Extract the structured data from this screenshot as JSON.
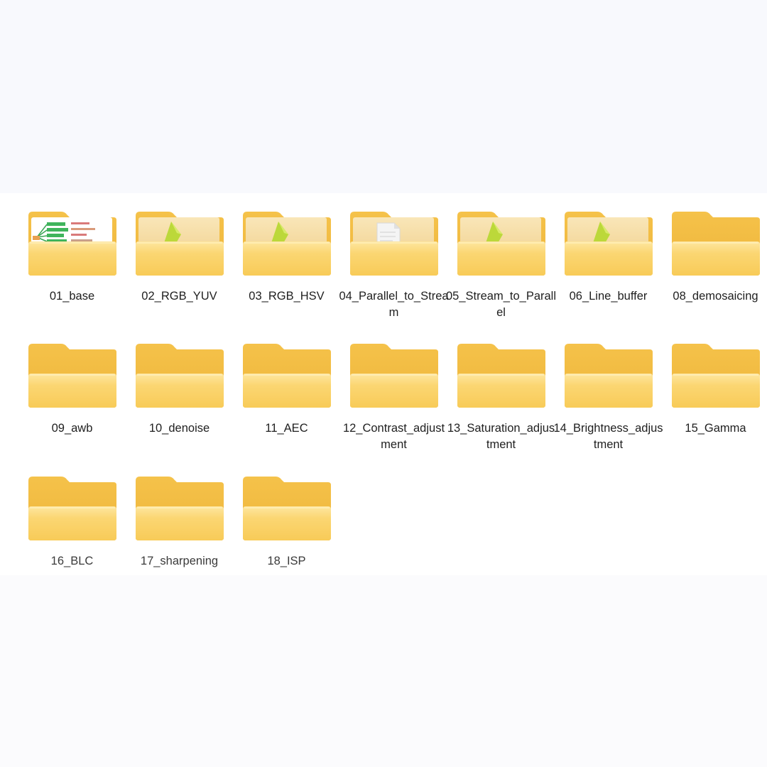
{
  "folders": [
    {
      "name": "01_base",
      "content": "diagram-preview"
    },
    {
      "name": "02_RGB_YUV",
      "content": "green-file"
    },
    {
      "name": "03_RGB_HSV",
      "content": "green-file"
    },
    {
      "name": "04_Parallel_to_Stream",
      "content": "document-file"
    },
    {
      "name": "05_Stream_to_Parallel",
      "content": "green-file"
    },
    {
      "name": "06_Line_buffer",
      "content": "green-file"
    },
    {
      "name": "08_demosaicing",
      "content": "empty"
    },
    {
      "name": "09_awb",
      "content": "empty"
    },
    {
      "name": "10_denoise",
      "content": "empty"
    },
    {
      "name": "11_AEC",
      "content": "empty"
    },
    {
      "name": "12_Contrast_adjustment",
      "content": "empty"
    },
    {
      "name": "13_Saturation_adjustment",
      "content": "empty"
    },
    {
      "name": "14_Brightness_adjustment",
      "content": "empty"
    },
    {
      "name": "15_Gamma",
      "content": "empty"
    },
    {
      "name": "16_BLC",
      "content": "empty"
    },
    {
      "name": "17_sharpening",
      "content": "empty"
    },
    {
      "name": "18_ISP",
      "content": "empty"
    }
  ],
  "colors": {
    "folder_back": "#f2bd45",
    "folder_front": "#fad26a",
    "folder_front_light": "#fde59c",
    "file_green": "#b9d83a",
    "text": "#1f1f1f"
  }
}
